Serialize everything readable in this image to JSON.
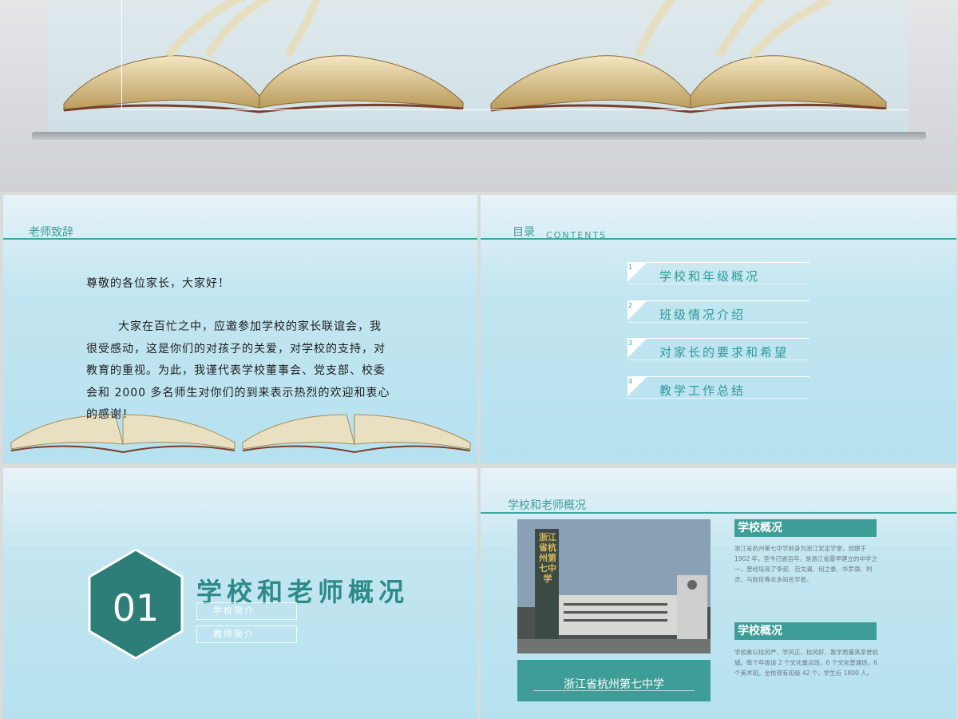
{
  "colors": {
    "teal": "#3f9d97",
    "teal_text": "#2d9b98",
    "slide_bg": "#c3e6f1"
  },
  "slide1": {
    "header": "老师致辞",
    "greeting": "尊敬的各位家长，大家好！",
    "body": "大家在百忙之中，应邀参加学校的家长联谊会，我很受感动，这是你们的对孩子的关爱，对学校的支持，对教育的重视。为此，我谨代表学校董事会、党支部、校委会和 2000 多名师生对你们的到来表示热烈的欢迎和衷心的感谢！"
  },
  "slide2": {
    "header": "目录",
    "header_en": "CONTENTS",
    "items": [
      {
        "num": "1",
        "label": "学校和年级概况"
      },
      {
        "num": "2",
        "label": "班级情况介绍"
      },
      {
        "num": "3",
        "label": "对家长的要求和希望"
      },
      {
        "num": "4",
        "label": "教学工作总结"
      }
    ]
  },
  "slide3": {
    "number": "01",
    "title": "学校和老师概况",
    "subs": [
      "学校简介",
      "教师简介"
    ]
  },
  "slide4": {
    "header": "学校和老师概况",
    "caption": "浙江省杭州第七中学",
    "sign_text": "浙江省杭州第七中学",
    "blocks": [
      {
        "tag": "学校概况",
        "text": "浙江省杭州第七中学前身为浙江安定学堂，创建于1902 年，至今已逾百年，是浙江省最早建立的中学之一，曾经培育了李叔、范文澜、何之泰、华罗庚、柯灵、马叙伦等众多知名学者。"
      },
      {
        "tag": "学校概况",
        "text": "学校素以校风严、学风正、校风好、教学质量高享誉杭城。每个年级设 2 个文化重点班、6 个文化普通班，6 个美术班。全校现有班级 42 个，学生近 1800 人。"
      }
    ]
  }
}
